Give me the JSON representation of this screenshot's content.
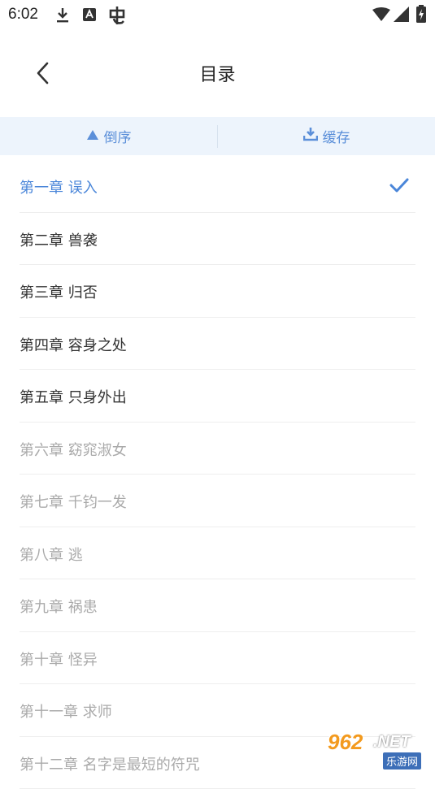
{
  "status_bar": {
    "time": "6:02",
    "icons": [
      "download-icon",
      "a-badge-icon",
      "bug-icon",
      "wifi-icon",
      "signal-icon",
      "battery-charging-icon"
    ]
  },
  "header": {
    "title": "目录",
    "back_icon": "chevron-left-icon"
  },
  "toolbar": {
    "reverse_label": "倒序",
    "reverse_icon": "triangle-up-icon",
    "cache_label": "缓存",
    "cache_icon": "download-tray-icon"
  },
  "colors": {
    "accent": "#4a86d9",
    "toolbar_bg": "#edf4fc",
    "text_cached": "#333333",
    "text_uncached": "#aaaaaa"
  },
  "chapters": [
    {
      "title": "第一章 误入",
      "state": "current"
    },
    {
      "title": "第二章 兽袭",
      "state": "cached"
    },
    {
      "title": "第三章 归否",
      "state": "cached"
    },
    {
      "title": "第四章 容身之处",
      "state": "cached"
    },
    {
      "title": "第五章 只身外出",
      "state": "cached"
    },
    {
      "title": "第六章 窈窕淑女",
      "state": "uncached"
    },
    {
      "title": "第七章 千钧一发",
      "state": "uncached"
    },
    {
      "title": "第八章 逃",
      "state": "uncached"
    },
    {
      "title": "第九章 祸患",
      "state": "uncached"
    },
    {
      "title": "第十章 怪异",
      "state": "uncached"
    },
    {
      "title": "第十一章 求师",
      "state": "uncached"
    },
    {
      "title": "第十二章 名字是最短的符咒",
      "state": "uncached"
    }
  ],
  "watermark": {
    "number": "962",
    "suffix": ".NET",
    "site": "乐游网"
  }
}
